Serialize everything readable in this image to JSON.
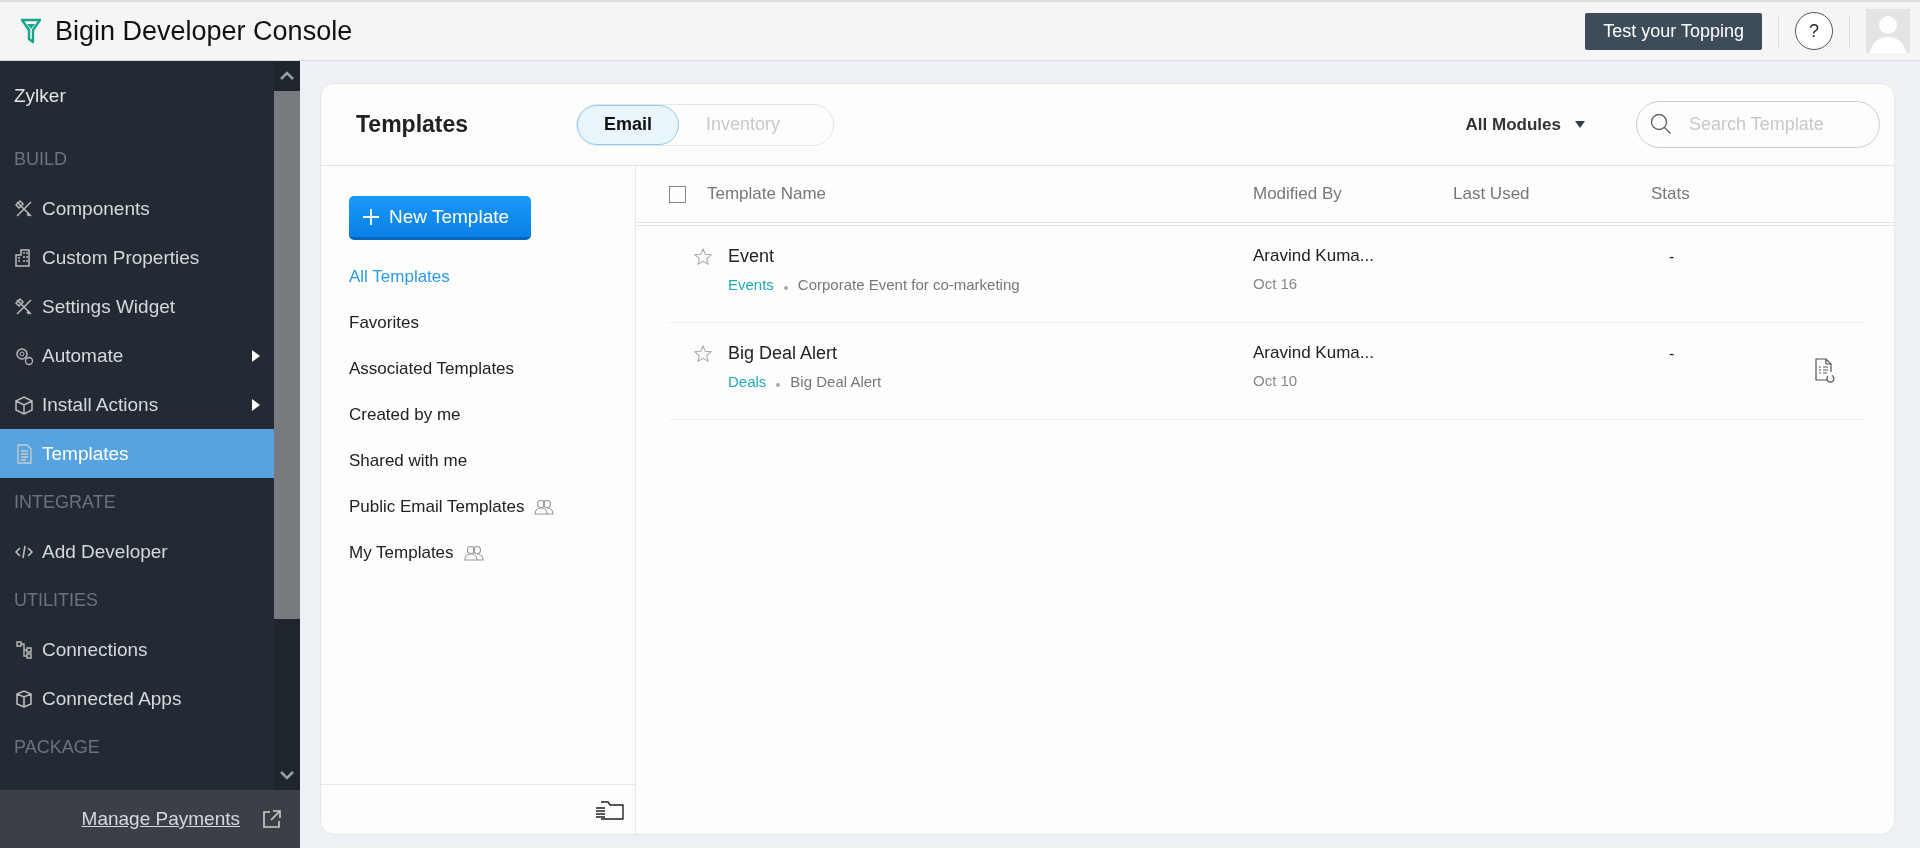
{
  "header": {
    "title": "Bigin Developer Console",
    "test_button": "Test your Topping",
    "help": "?"
  },
  "sidebar": {
    "org": "Zylker",
    "sections": [
      {
        "heading": "BUILD",
        "items": [
          {
            "label": "Components",
            "has_submenu": false,
            "selected": false
          },
          {
            "label": "Custom Properties",
            "has_submenu": false,
            "selected": false
          },
          {
            "label": "Settings Widget",
            "has_submenu": false,
            "selected": false
          },
          {
            "label": "Automate",
            "has_submenu": true,
            "selected": false
          },
          {
            "label": "Install Actions",
            "has_submenu": true,
            "selected": false
          },
          {
            "label": "Templates",
            "has_submenu": false,
            "selected": true
          }
        ]
      },
      {
        "heading": "INTEGRATE",
        "items": [
          {
            "label": "Add Developer",
            "has_submenu": false,
            "selected": false
          }
        ]
      },
      {
        "heading": "UTILITIES",
        "items": [
          {
            "label": "Connections",
            "has_submenu": false,
            "selected": false
          },
          {
            "label": "Connected Apps",
            "has_submenu": false,
            "selected": false
          }
        ]
      },
      {
        "heading": "PACKAGE"
      }
    ],
    "footer_link": "Manage Payments"
  },
  "templates": {
    "title": "Templates",
    "tabs": [
      {
        "label": "Email",
        "selected": true
      },
      {
        "label": "Inventory",
        "selected": false
      }
    ],
    "module_filter": "All Modules",
    "search": {
      "placeholder": "Search Template"
    },
    "new_button": "New Template",
    "filters": [
      {
        "label": "All Templates",
        "selected": true,
        "shared": false
      },
      {
        "label": "Favorites",
        "selected": false,
        "shared": false
      },
      {
        "label": "Associated Templates",
        "selected": false,
        "shared": false
      },
      {
        "label": "Created by me",
        "selected": false,
        "shared": false
      },
      {
        "label": "Shared with me",
        "selected": false,
        "shared": false
      },
      {
        "label": "Public Email Templates",
        "selected": false,
        "shared": true
      },
      {
        "label": "My Templates",
        "selected": false,
        "shared": true
      }
    ],
    "table": {
      "columns": [
        "Template Name",
        "Modified By",
        "Last Used",
        "Stats"
      ],
      "select_all": false,
      "rows": [
        {
          "name": "Event",
          "favorite": false,
          "module": "Events",
          "description": "Corporate Event for co-marketing",
          "modified_by": "Aravind Kuma...",
          "modified_on": "Oct 16",
          "stats": "-",
          "show_action": false
        },
        {
          "name": "Big Deal Alert",
          "favorite": false,
          "module": "Deals",
          "description": "Big Deal Alert",
          "modified_by": "Aravind Kuma...",
          "modified_on": "Oct 10",
          "stats": "-",
          "show_action": true
        }
      ]
    }
  }
}
